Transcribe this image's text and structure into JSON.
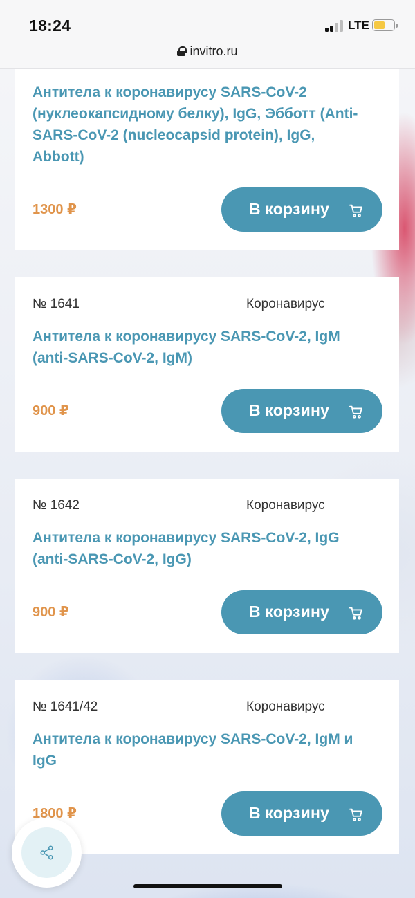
{
  "status_bar": {
    "time": "18:24",
    "network": "LTE",
    "signal_bars_active": 2,
    "signal_bars_total": 4,
    "battery_level": 0.55,
    "battery_color": "#f5c842"
  },
  "browser": {
    "url": "invitro.ru",
    "lock_icon": "lock-icon"
  },
  "cards": [
    {
      "number": "",
      "category": "",
      "title": "Антитела к коронавирусу SARS-CoV-2 (нуклеокапсидному белку), IgG, Эбботт (Anti-SARS-CoV-2 (nucleocapsid protein), IgG, Abbott)",
      "price": "1300 ₽",
      "button_label": "В корзину"
    },
    {
      "number": "№ 1641",
      "category": "Коронавирус",
      "title": "Антитела к коронавирусу SARS-CoV-2, IgM (anti-SARS-CoV-2, IgM)",
      "price": "900 ₽",
      "button_label": "В корзину"
    },
    {
      "number": "№ 1642",
      "category": "Коронавирус",
      "title": "Антитела к коронавирусу SARS-CoV-2, IgG (anti-SARS-CoV-2, IgG)",
      "price": "900 ₽",
      "button_label": "В корзину"
    },
    {
      "number": "№ 1641/42",
      "category": "Коронавирус",
      "title": "Антитела к коронавирусу SARS-CoV-2, IgM и IgG",
      "price": "1800 ₽",
      "button_label": "В корзину"
    }
  ],
  "icons": {
    "cart": "cart-icon",
    "share": "share-icon"
  },
  "colors": {
    "accent": "#4a97b3",
    "price": "#e0944b",
    "share_fab_inner": "#e3f1f5"
  }
}
